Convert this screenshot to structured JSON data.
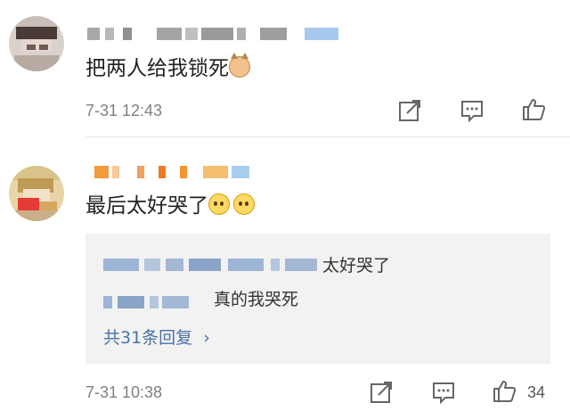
{
  "comments": [
    {
      "text": "把两人给我锁死",
      "emoji": "cat-face",
      "time": "7-31 12:43",
      "likes": ""
    },
    {
      "text": "最后太好哭了",
      "emoji": "crying-face",
      "time": "7-31 10:38",
      "likes": "34",
      "replies": [
        {
          "text": "太好哭了"
        },
        {
          "text": "真的我哭死"
        }
      ],
      "more_replies": "共31条回复"
    }
  ],
  "icons": {
    "share": "share-icon",
    "comment": "comment-icon",
    "like": "thumbs-up-icon"
  },
  "colors": {
    "link": "#4b72a6",
    "time": "#808080",
    "reply_bg": "#f2f2f2"
  }
}
